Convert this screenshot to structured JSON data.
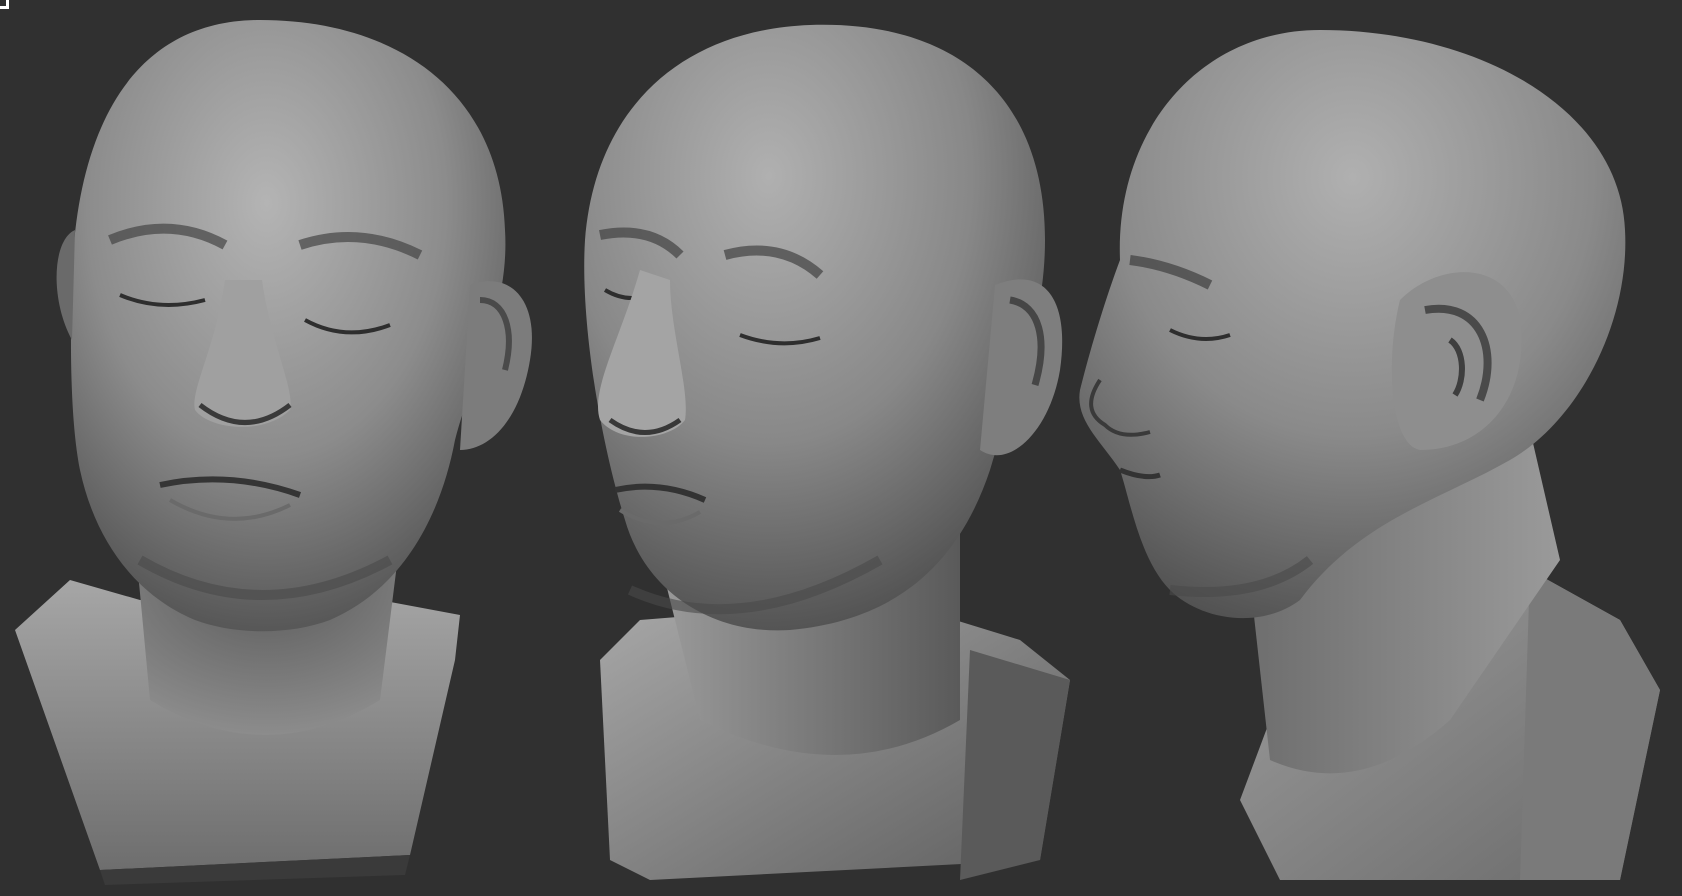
{
  "viewport": {
    "background_color": "#303030",
    "material_color": "#8a8a8a"
  },
  "views": [
    {
      "id": "front",
      "icon": "sculpt-bust-front"
    },
    {
      "id": "threequarter",
      "icon": "sculpt-bust-three-quarter"
    },
    {
      "id": "profile",
      "icon": "sculpt-bust-profile"
    }
  ]
}
